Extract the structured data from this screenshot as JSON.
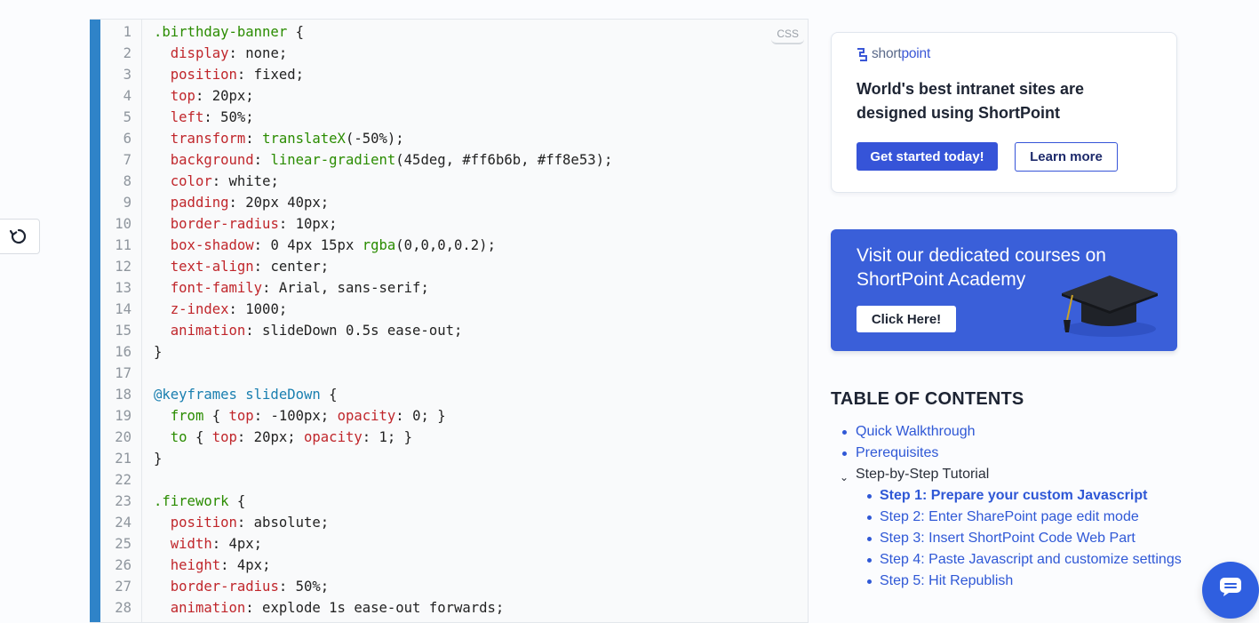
{
  "code": {
    "language": "CSS",
    "lines": [
      {
        "n": "1",
        "t": [
          {
            "c": "sel",
            "s": ".birthday-banner"
          },
          {
            "c": "",
            "s": " {"
          }
        ]
      },
      {
        "n": "2",
        "t": [
          {
            "c": "",
            "s": "  "
          },
          {
            "c": "prop",
            "s": "display"
          },
          {
            "c": "",
            "s": ": none;"
          }
        ]
      },
      {
        "n": "3",
        "t": [
          {
            "c": "",
            "s": "  "
          },
          {
            "c": "prop",
            "s": "position"
          },
          {
            "c": "",
            "s": ": fixed;"
          }
        ]
      },
      {
        "n": "4",
        "t": [
          {
            "c": "",
            "s": "  "
          },
          {
            "c": "prop",
            "s": "top"
          },
          {
            "c": "",
            "s": ": 20px;"
          }
        ]
      },
      {
        "n": "5",
        "t": [
          {
            "c": "",
            "s": "  "
          },
          {
            "c": "prop",
            "s": "left"
          },
          {
            "c": "",
            "s": ": 50%;"
          }
        ]
      },
      {
        "n": "6",
        "t": [
          {
            "c": "",
            "s": "  "
          },
          {
            "c": "prop",
            "s": "transform"
          },
          {
            "c": "",
            "s": ": "
          },
          {
            "c": "fn",
            "s": "translateX"
          },
          {
            "c": "",
            "s": "(-50%);"
          }
        ]
      },
      {
        "n": "7",
        "t": [
          {
            "c": "",
            "s": "  "
          },
          {
            "c": "prop",
            "s": "background"
          },
          {
            "c": "",
            "s": ": "
          },
          {
            "c": "fn",
            "s": "linear-gradient"
          },
          {
            "c": "",
            "s": "(45deg, #ff6b6b, #ff8e53);"
          }
        ]
      },
      {
        "n": "8",
        "t": [
          {
            "c": "",
            "s": "  "
          },
          {
            "c": "prop",
            "s": "color"
          },
          {
            "c": "",
            "s": ": white;"
          }
        ]
      },
      {
        "n": "9",
        "t": [
          {
            "c": "",
            "s": "  "
          },
          {
            "c": "prop",
            "s": "padding"
          },
          {
            "c": "",
            "s": ": 20px 40px;"
          }
        ]
      },
      {
        "n": "10",
        "t": [
          {
            "c": "",
            "s": "  "
          },
          {
            "c": "prop",
            "s": "border-radius"
          },
          {
            "c": "",
            "s": ": 10px;"
          }
        ]
      },
      {
        "n": "11",
        "t": [
          {
            "c": "",
            "s": "  "
          },
          {
            "c": "prop",
            "s": "box-shadow"
          },
          {
            "c": "",
            "s": ": 0 4px 15px "
          },
          {
            "c": "fn",
            "s": "rgba"
          },
          {
            "c": "",
            "s": "(0,0,0,0.2);"
          }
        ]
      },
      {
        "n": "12",
        "t": [
          {
            "c": "",
            "s": "  "
          },
          {
            "c": "prop",
            "s": "text-align"
          },
          {
            "c": "",
            "s": ": center;"
          }
        ]
      },
      {
        "n": "13",
        "t": [
          {
            "c": "",
            "s": "  "
          },
          {
            "c": "prop",
            "s": "font-family"
          },
          {
            "c": "",
            "s": ": Arial, sans-serif;"
          }
        ]
      },
      {
        "n": "14",
        "t": [
          {
            "c": "",
            "s": "  "
          },
          {
            "c": "prop",
            "s": "z-index"
          },
          {
            "c": "",
            "s": ": 1000;"
          }
        ]
      },
      {
        "n": "15",
        "t": [
          {
            "c": "",
            "s": "  "
          },
          {
            "c": "prop",
            "s": "animation"
          },
          {
            "c": "",
            "s": ": slideDown 0.5s ease-out;"
          }
        ]
      },
      {
        "n": "16",
        "t": [
          {
            "c": "",
            "s": "}"
          }
        ]
      },
      {
        "n": "17",
        "t": [
          {
            "c": "",
            "s": ""
          }
        ]
      },
      {
        "n": "18",
        "t": [
          {
            "c": "at",
            "s": "@keyframes slideDown"
          },
          {
            "c": "",
            "s": " {"
          }
        ]
      },
      {
        "n": "19",
        "t": [
          {
            "c": "",
            "s": "  "
          },
          {
            "c": "kw",
            "s": "from"
          },
          {
            "c": "",
            "s": " { "
          },
          {
            "c": "prop",
            "s": "top"
          },
          {
            "c": "",
            "s": ": -100px; "
          },
          {
            "c": "prop",
            "s": "opacity"
          },
          {
            "c": "",
            "s": ": 0; }"
          }
        ]
      },
      {
        "n": "20",
        "t": [
          {
            "c": "",
            "s": "  "
          },
          {
            "c": "kw",
            "s": "to"
          },
          {
            "c": "",
            "s": " { "
          },
          {
            "c": "prop",
            "s": "top"
          },
          {
            "c": "",
            "s": ": 20px; "
          },
          {
            "c": "prop",
            "s": "opacity"
          },
          {
            "c": "",
            "s": ": 1; }"
          }
        ]
      },
      {
        "n": "21",
        "t": [
          {
            "c": "",
            "s": "}"
          }
        ]
      },
      {
        "n": "22",
        "t": [
          {
            "c": "",
            "s": ""
          }
        ]
      },
      {
        "n": "23",
        "t": [
          {
            "c": "sel",
            "s": ".firework"
          },
          {
            "c": "",
            "s": " {"
          }
        ]
      },
      {
        "n": "24",
        "t": [
          {
            "c": "",
            "s": "  "
          },
          {
            "c": "prop",
            "s": "position"
          },
          {
            "c": "",
            "s": ": absolute;"
          }
        ]
      },
      {
        "n": "25",
        "t": [
          {
            "c": "",
            "s": "  "
          },
          {
            "c": "prop",
            "s": "width"
          },
          {
            "c": "",
            "s": ": 4px;"
          }
        ]
      },
      {
        "n": "26",
        "t": [
          {
            "c": "",
            "s": "  "
          },
          {
            "c": "prop",
            "s": "height"
          },
          {
            "c": "",
            "s": ": 4px;"
          }
        ]
      },
      {
        "n": "27",
        "t": [
          {
            "c": "",
            "s": "  "
          },
          {
            "c": "prop",
            "s": "border-radius"
          },
          {
            "c": "",
            "s": ": 50%;"
          }
        ]
      },
      {
        "n": "28",
        "t": [
          {
            "c": "",
            "s": "  "
          },
          {
            "c": "prop",
            "s": "animation"
          },
          {
            "c": "",
            "s": ": explode 1s ease-out forwards;"
          }
        ]
      }
    ]
  },
  "promo": {
    "logo_prefix": "short",
    "logo_suffix": "point",
    "headline": "World's best intranet sites are designed using ShortPoint",
    "primary_button": "Get started today!",
    "secondary_button": "Learn more"
  },
  "academy": {
    "text": "Visit our dedicated courses on ShortPoint Academy",
    "button": "Click Here!",
    "icon": "graduation-cap"
  },
  "toc": {
    "title": "TABLE OF CONTENTS",
    "items": [
      {
        "label": "Quick Walkthrough"
      },
      {
        "label": "Prerequisites"
      }
    ],
    "parent": {
      "label": "Step-by-Step Tutorial"
    },
    "subitems": [
      {
        "label": "Step 1: Prepare your custom Javascript",
        "active": true
      },
      {
        "label": "Step 2: Enter SharePoint page edit mode"
      },
      {
        "label": "Step 3: Insert ShortPoint Code Web Part"
      },
      {
        "label": "Step 4: Paste Javascript and customize settings"
      },
      {
        "label": "Step 5: Hit Republish"
      }
    ]
  },
  "colors": {
    "accent": "#2f83c8",
    "brand": "#3654d8",
    "link": "#2f58d6"
  },
  "icons": {
    "float_button": "refresh-icon",
    "chat": "chat-icon"
  }
}
